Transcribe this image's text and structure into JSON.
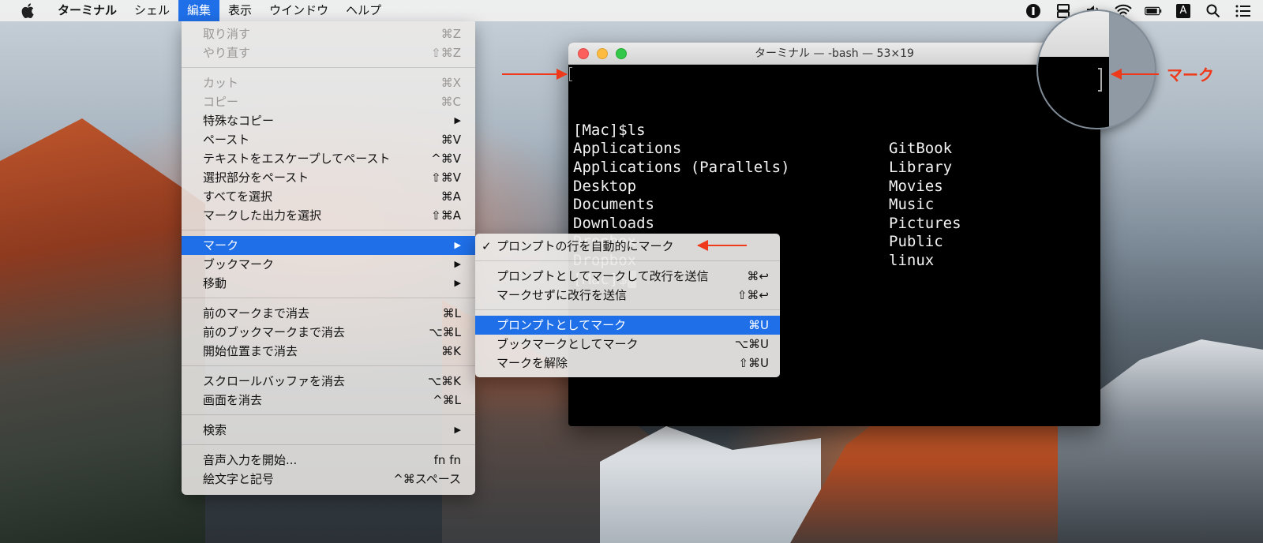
{
  "menubar": {
    "app_name": "ターミナル",
    "menus": [
      "シェル",
      "編集",
      "表示",
      "ウインドウ",
      "ヘルプ"
    ],
    "active_menu": "編集",
    "status_icons": [
      "1password-icon",
      "display-icon",
      "volume-icon",
      "wifi-icon",
      "battery-icon",
      "input-source-icon",
      "spotlight-icon",
      "notification-center-icon"
    ],
    "input_source_letter": "A"
  },
  "edit_menu": {
    "groups": [
      [
        {
          "label": "取り消す",
          "shortcut": "⌘Z",
          "enabled": false
        },
        {
          "label": "やり直す",
          "shortcut": "⇧⌘Z",
          "enabled": false
        }
      ],
      [
        {
          "label": "カット",
          "shortcut": "⌘X",
          "enabled": false
        },
        {
          "label": "コピー",
          "shortcut": "⌘C",
          "enabled": false
        },
        {
          "label": "特殊なコピー",
          "shortcut": "▶",
          "enabled": true
        },
        {
          "label": "ペースト",
          "shortcut": "⌘V",
          "enabled": true
        },
        {
          "label": "テキストをエスケープしてペースト",
          "shortcut": "^⌘V",
          "enabled": true
        },
        {
          "label": "選択部分をペースト",
          "shortcut": "⇧⌘V",
          "enabled": true
        },
        {
          "label": "すべてを選択",
          "shortcut": "⌘A",
          "enabled": true
        },
        {
          "label": "マークした出力を選択",
          "shortcut": "⇧⌘A",
          "enabled": true
        }
      ],
      [
        {
          "label": "マーク",
          "shortcut": "▶",
          "enabled": true,
          "highlighted": true
        },
        {
          "label": "ブックマーク",
          "shortcut": "▶",
          "enabled": true
        },
        {
          "label": "移動",
          "shortcut": "▶",
          "enabled": true
        }
      ],
      [
        {
          "label": "前のマークまで消去",
          "shortcut": "⌘L",
          "enabled": true
        },
        {
          "label": "前のブックマークまで消去",
          "shortcut": "⌥⌘L",
          "enabled": true
        },
        {
          "label": "開始位置まで消去",
          "shortcut": "⌘K",
          "enabled": true
        }
      ],
      [
        {
          "label": "スクロールバッファを消去",
          "shortcut": "⌥⌘K",
          "enabled": true
        },
        {
          "label": "画面を消去",
          "shortcut": "^⌘L",
          "enabled": true
        }
      ],
      [
        {
          "label": "検索",
          "shortcut": "▶",
          "enabled": true
        }
      ],
      [
        {
          "label": "音声入力を開始...",
          "shortcut": "fn fn",
          "enabled": true
        },
        {
          "label": "絵文字と記号",
          "shortcut": "^⌘スペース",
          "enabled": true
        }
      ]
    ]
  },
  "mark_submenu": {
    "items": [
      {
        "label": "プロンプトの行を自動的にマーク",
        "shortcut": "",
        "checked": true
      },
      {
        "separator": true
      },
      {
        "label": "プロンプトとしてマークして改行を送信",
        "shortcut": "⌘↩"
      },
      {
        "label": "マークせずに改行を送信",
        "shortcut": "⇧⌘↩"
      },
      {
        "separator": true
      },
      {
        "label": "プロンプトとしてマーク",
        "shortcut": "⌘U",
        "highlighted": true
      },
      {
        "label": "ブックマークとしてマーク",
        "shortcut": "⌥⌘U"
      },
      {
        "label": "マークを解除",
        "shortcut": "⇧⌘U"
      }
    ],
    "check_glyph": "✓"
  },
  "terminal": {
    "title": "ターミナル — -bash — 53×19",
    "lines": [
      {
        "col1": "[Mac]$ls",
        "col2": ""
      },
      {
        "col1": "Applications",
        "col2": "GitBook"
      },
      {
        "col1": "Applications (Parallels)",
        "col2": "Library"
      },
      {
        "col1": "Desktop",
        "col2": "Movies"
      },
      {
        "col1": "Documents",
        "col2": "Music"
      },
      {
        "col1": "Downloads",
        "col2": "Pictures"
      },
      {
        "col1": "Dropbox",
        "col2": "Public"
      },
      {
        "col1": "Dropbox",
        "col2": "linux"
      }
    ],
    "prompt": "[Mac]$"
  },
  "annotations": {
    "mark_label": "マーク"
  },
  "colors": {
    "accent": "#1f6fe8",
    "annotation": "#ee3a1a"
  }
}
